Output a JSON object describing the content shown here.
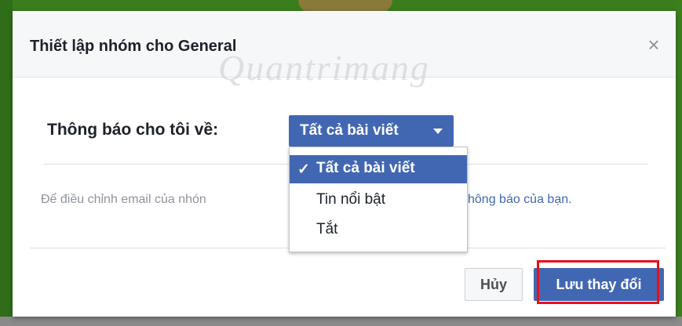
{
  "dialog": {
    "title": "Thiết lập nhóm cho General",
    "close_symbol": "×",
    "watermark": "Quantrimang"
  },
  "notify": {
    "label": "Thông báo cho tôi về:",
    "selected": "Tất cả bài viết"
  },
  "dropdown": {
    "check_symbol": "✓",
    "items": [
      "Tất cả bài viết",
      "Tin nổi bật",
      "Tắt"
    ]
  },
  "info": {
    "text_prefix": "Để điều chỉnh email của nhón",
    "link_text": "hông báo của bạn."
  },
  "footer": {
    "cancel_label": "Hủy",
    "save_label": "Lưu thay đổi"
  },
  "colors": {
    "accent": "#4267b2",
    "highlight": "#e8101a"
  }
}
